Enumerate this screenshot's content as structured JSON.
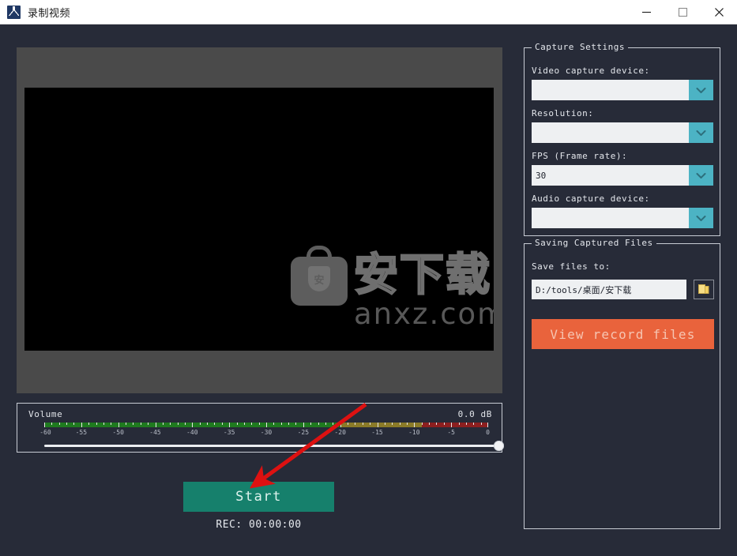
{
  "window": {
    "title": "录制视频",
    "icon": "app-logo-icon",
    "controls": {
      "minimize": "minimize-icon",
      "maximize": "maximize-icon",
      "close": "close-icon"
    }
  },
  "preview": {
    "watermark_cn": "安下载",
    "watermark_domain": "anxz.com",
    "watermark_badge": "安"
  },
  "volume": {
    "label": "Volume",
    "level_db": "0.0 dB",
    "scale_ticks": [
      "-60",
      "-55",
      "-50",
      "-45",
      "-40",
      "-35",
      "-30",
      "-25",
      "-20",
      "-15",
      "-10",
      "-5",
      "0"
    ],
    "slider_value_percent": 100,
    "meter_colors": {
      "green": "#1f7a1f",
      "yellow": "#8a7a28",
      "red": "#8c1f1f"
    }
  },
  "transport": {
    "start_label": "Start",
    "rec_label": "REC: 00:00:00",
    "start_color": "#16806c"
  },
  "capture_settings": {
    "legend": "Capture Settings",
    "fields": [
      {
        "label": "Video capture device:",
        "value": ""
      },
      {
        "label": "Resolution:",
        "value": ""
      },
      {
        "label": "FPS (Frame rate):",
        "value": "30"
      },
      {
        "label": "Audio capture device:",
        "value": ""
      }
    ],
    "dropdown_color": "#4cb3c4"
  },
  "saving_files": {
    "legend": "Saving Captured Files",
    "save_to_label": "Save files to:",
    "save_path": "D:/tools/桌面/安下载",
    "browse_icon": "folder-icon",
    "view_button_label": "View record files",
    "view_button_color": "#e9633c"
  },
  "annotation": {
    "arrow_color": "#dd1111",
    "from": [
      463,
      512
    ],
    "to": [
      325,
      612
    ]
  }
}
